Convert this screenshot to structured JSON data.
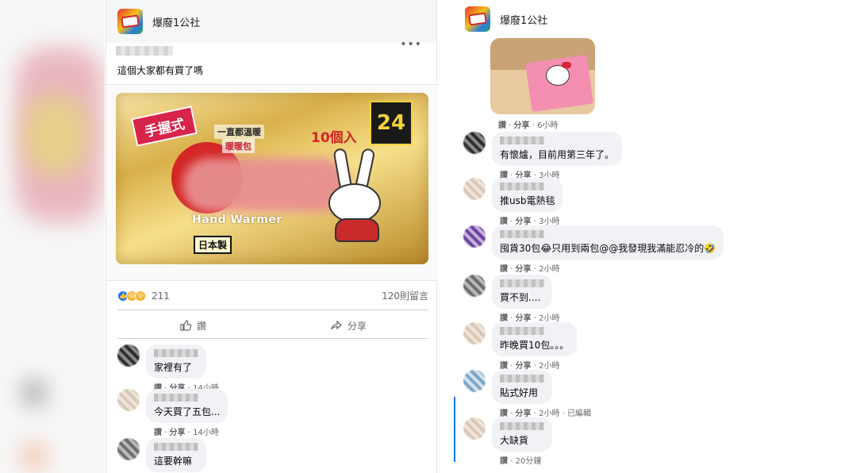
{
  "left_post": {
    "page_name": "爆廢1公社",
    "more": "•••",
    "text": "這個大家都有買了嗎",
    "image": {
      "tag": "手握式",
      "line1": "一直都溫暖",
      "line2": "暖暖包",
      "count": "10個入",
      "badge": "24",
      "brand": "Hand Warmer",
      "origin": "日本製"
    },
    "reaction_count": "211",
    "comments_count": "120則留言",
    "actions": {
      "like": "讚",
      "share": "分享"
    },
    "comments": [
      {
        "text": "家裡有了",
        "meta_like": "讚",
        "meta_share": "分享",
        "time": "14小時"
      },
      {
        "text": "今天買了五包...",
        "meta_like": "讚",
        "meta_share": "分享",
        "time": "14小時"
      },
      {
        "text": "這要幹嘛"
      }
    ]
  },
  "right_post": {
    "page_name": "爆廢1公社",
    "photo_meta": {
      "like": "讚",
      "share": "分享",
      "time": "6小時"
    },
    "comments": [
      {
        "text": "有懷爐，目前用第三年了。",
        "like": "讚",
        "share": "分享",
        "time": "3小時"
      },
      {
        "text": "推usb電熱毯",
        "like": "讚",
        "share": "分享",
        "time": "3小時"
      },
      {
        "text": "囤貨30包😂只用到兩包@@我發現我滿能忍冷的🤣",
        "like": "讚",
        "share": "分享",
        "time": "2小時"
      },
      {
        "text": "買不到....",
        "like": "讚",
        "share": "分享",
        "time": "2小時"
      },
      {
        "text": "昨晚買10包。。。",
        "like": "讚",
        "share": "分享",
        "time": "2小時"
      },
      {
        "text": "貼式好用",
        "like": "讚",
        "share": "分享",
        "time": "2小時",
        "edited": "已編輯"
      },
      {
        "text": "大缺貨",
        "like": "讚",
        "time": "20分鐘"
      }
    ]
  },
  "colors": {
    "like_blue": "#1877f2",
    "bubble_gray": "#f0f2f5",
    "meta_gray": "#65676b"
  }
}
